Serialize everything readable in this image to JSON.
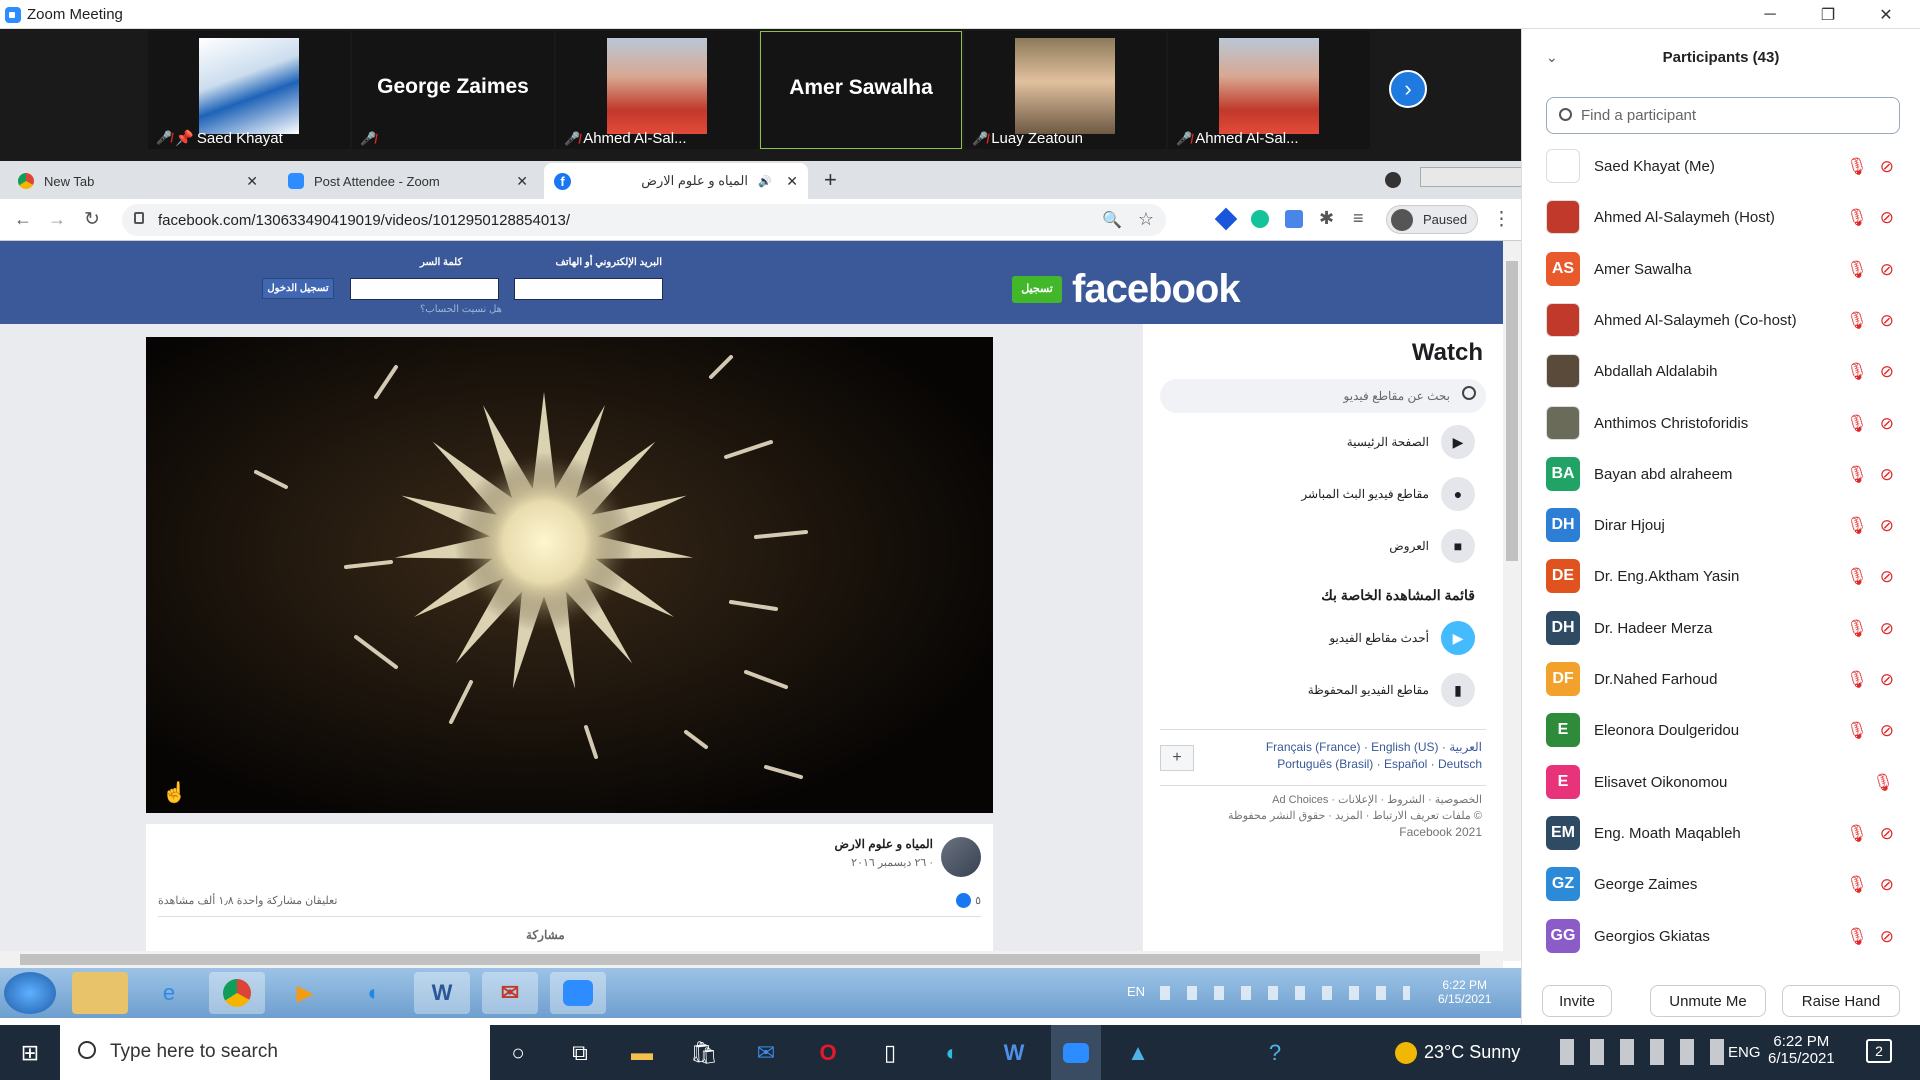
{
  "zoom": {
    "title": "Zoom Meeting",
    "minimize": "─",
    "maximize": "❐",
    "close": "✕",
    "thumbnails": [
      {
        "label": "Saed Khayat",
        "pin": "📌"
      },
      {
        "center_name": "George Zaimes",
        "label": ""
      },
      {
        "label": "Ahmed Al-Sal..."
      },
      {
        "center_name": "Amer Sawalha",
        "label": ""
      },
      {
        "label": "Luay Zeatoun"
      },
      {
        "label": "Ahmed Al-Sal..."
      }
    ],
    "mic_off": "🎤̸",
    "next_page": "›"
  },
  "browser": {
    "tabs": [
      {
        "title": "New Tab",
        "close": "✕"
      },
      {
        "title": "Post Attendee - Zoom",
        "close": "✕"
      },
      {
        "title": "المياه و علوم الارض",
        "close": "✕",
        "audio": "🔊"
      }
    ],
    "new_tab": "+",
    "back": "←",
    "forward": "→",
    "reload": "↻",
    "url": "facebook.com/130633490419019/videos/1012950128854013/",
    "profile_status": "Paused",
    "menu": "⋮"
  },
  "facebook": {
    "logo": "facebook",
    "signup": "تسجيل",
    "email_label": "البريد الإلكتروني أو الهاتف",
    "password_label": "كلمة السر",
    "login": "تسجيل الدخول",
    "forgot": "هل نسيت الحساب؟",
    "watch_title": "Watch",
    "watch_search_placeholder": "بحث عن مقاطع فيديو",
    "menu": [
      {
        "label": "الصفحة الرئيسية",
        "icon": "▶"
      },
      {
        "label": "مقاطع فيديو البث المباشر",
        "icon": "●"
      },
      {
        "label": "العروض",
        "icon": "■"
      }
    ],
    "watchlist_title": "قائمة المشاهدة الخاصة بك",
    "watchlist": [
      {
        "label": "أحدث مقاطع الفيديو",
        "icon": "▶"
      },
      {
        "label": "مقاطع الفيديو المحفوظة",
        "icon": "▮"
      }
    ],
    "languages_line1": "Français (France) · English (US) · العربية",
    "languages_line2": "Português (Brasil) · Español · Deutsch",
    "lang_add": "+",
    "footer_line1": "Ad Choices · الخصوصية · الشروط · الإعلانات",
    "footer_line2": "ملفات تعريف الارتباط · المزيد · حقوق النشر محفوظة ©",
    "footer_line3": "Facebook 2021",
    "post_page_name": "المياه و علوم الارض",
    "post_date": "٢٦ ديسمبر ٢٠١٦ · ",
    "post_likes": "٥",
    "post_stats": "تعليقان  مشاركة واحدة  ١٫٨ ألف مشاهدة",
    "post_share": "مشاركة"
  },
  "win7_taskbar": {
    "lang": "EN",
    "time": "6:22 PM",
    "date": "6/15/2021"
  },
  "participants": {
    "title": "Participants (43)",
    "search_placeholder": "Find a participant",
    "list": [
      {
        "name": "Saed Khayat (Me)",
        "initials": "",
        "color": "#ffffff"
      },
      {
        "name": "Ahmed Al-Salaymeh (Host)",
        "initials": "",
        "color": "#c0392b"
      },
      {
        "name": "Amer Sawalha",
        "initials": "AS",
        "color": "#e8592b"
      },
      {
        "name": "Ahmed Al-Salaymeh (Co-host)",
        "initials": "",
        "color": "#c0392b"
      },
      {
        "name": "Abdallah Aldalabih",
        "initials": "",
        "color": "#5a4a3a"
      },
      {
        "name": "Anthimos Christoforidis",
        "initials": "",
        "color": "#6b6b5a"
      },
      {
        "name": "Bayan abd  alraheem",
        "initials": "BA",
        "color": "#21a366"
      },
      {
        "name": "Dirar Hjouj",
        "initials": "DH",
        "color": "#2d7fd6"
      },
      {
        "name": "Dr. Eng.Aktham Yasin",
        "initials": "DE",
        "color": "#e0531e"
      },
      {
        "name": "Dr. Hadeer Merza",
        "initials": "DH",
        "color": "#2f4a63"
      },
      {
        "name": "Dr.Nahed Farhoud",
        "initials": "DF",
        "color": "#f2a22c"
      },
      {
        "name": "Eleonora Doulgeridou",
        "initials": "E",
        "color": "#2e8b3a"
      },
      {
        "name": "Elisavet Oikonomou",
        "initials": "E",
        "color": "#e8337a"
      },
      {
        "name": "Eng. Moath Maqableh",
        "initials": "EM",
        "color": "#2f4a63"
      },
      {
        "name": "George Zaimes",
        "initials": "GZ",
        "color": "#2d8ad6"
      },
      {
        "name": "Georgios Gkiatas",
        "initials": "GG",
        "color": "#8b5cc7"
      }
    ],
    "invite": "Invite",
    "unmute": "Unmute Me",
    "raise": "Raise Hand"
  },
  "win10_taskbar": {
    "search_placeholder": "Type here to search",
    "temp": "23°C  Sunny",
    "lang": "ENG",
    "time": "6:22 PM",
    "date": "6/15/2021",
    "notifications": "2"
  }
}
